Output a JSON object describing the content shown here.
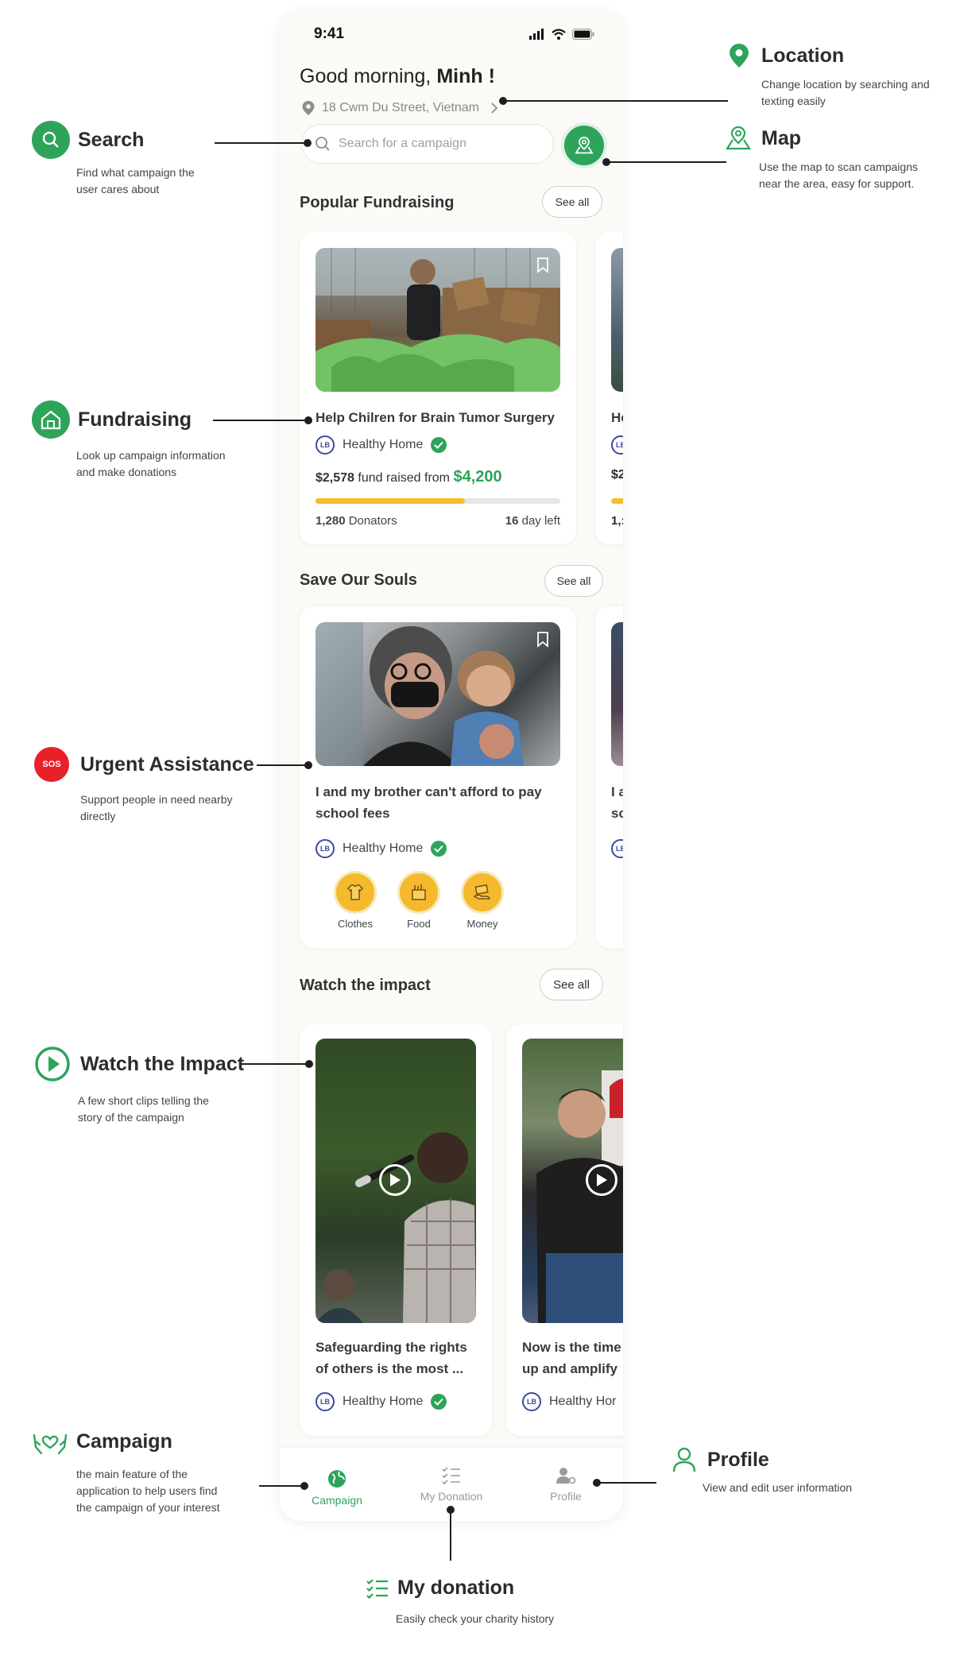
{
  "status_bar": {
    "time": "9:41"
  },
  "header": {
    "greeting": "Good morning,",
    "user_name": "Minh !",
    "address": "18 Cwm Du Street, Vietnam"
  },
  "search": {
    "placeholder": "Search for a campaign"
  },
  "popular": {
    "title": "Popular Fundraising",
    "see_all": "See all",
    "card": {
      "title": "Help Chilren for Brain Tumor Surgery",
      "org": "Healthy Home",
      "raised": "$2,578",
      "raised_text": "fund raised from",
      "goal": "$4,200",
      "progress": 0.61,
      "donators_count": "1,280",
      "donators_label": "Donators",
      "days_count": "16",
      "days_label": "day left"
    },
    "card2_peek": {
      "title": "He",
      "amount": "$2",
      "count": "1,:"
    }
  },
  "souls": {
    "title": "Save Our Souls",
    "see_all": "See all",
    "card": {
      "title_line1": "I and my brother can't afford to pay",
      "title_line2": "school fees",
      "org": "Healthy Home",
      "needs": [
        "Clothes",
        "Food",
        "Money"
      ]
    },
    "card2_peek": {
      "line1": "I a",
      "line2": "sc"
    }
  },
  "impact": {
    "title": "Watch the impact",
    "see_all": "See all",
    "videos": [
      {
        "title_line1": "Safeguarding the rights",
        "title_line2": "of others is the most ...",
        "org": "Healthy Home"
      },
      {
        "title_line1": "Now is the time",
        "title_line2": "up and amplify",
        "org": "Healthy Hor"
      }
    ]
  },
  "tabbar": {
    "tabs": [
      "Campaign",
      "My Donation",
      "Profile"
    ],
    "active": "Campaign"
  },
  "annotations": {
    "search": {
      "title": "Search",
      "desc": [
        "Find what campaign the",
        "user cares about"
      ]
    },
    "location": {
      "title": "Location",
      "desc": [
        "Change location by searching and",
        "texting easily"
      ]
    },
    "map": {
      "title": "Map",
      "desc": [
        "Use the map to scan campaigns",
        "near the area, easy for support."
      ]
    },
    "fundraising": {
      "title": "Fundraising",
      "desc": [
        "Look up campaign information",
        "and make donations"
      ]
    },
    "urgent": {
      "badge": "SOS",
      "title": "Urgent Assistance",
      "desc": [
        "Support people in need nearby",
        "directly"
      ]
    },
    "watch": {
      "title": "Watch the Impact",
      "desc": [
        "A few short clips telling the",
        "story of the campaign"
      ]
    },
    "campaign": {
      "title": "Campaign",
      "desc": [
        "the main feature of the",
        "application to help users find",
        "the campaign of your  interest"
      ]
    },
    "profile": {
      "title": "Profile",
      "desc": [
        "View and edit user information"
      ]
    },
    "my_donation": {
      "title": "My donation",
      "desc": [
        "Easily check your charity history"
      ]
    }
  },
  "colors": {
    "accent": "#2ea45a",
    "progress": "#f6bd2c",
    "sos": "#e8202a",
    "background": "#fbfaf6"
  }
}
